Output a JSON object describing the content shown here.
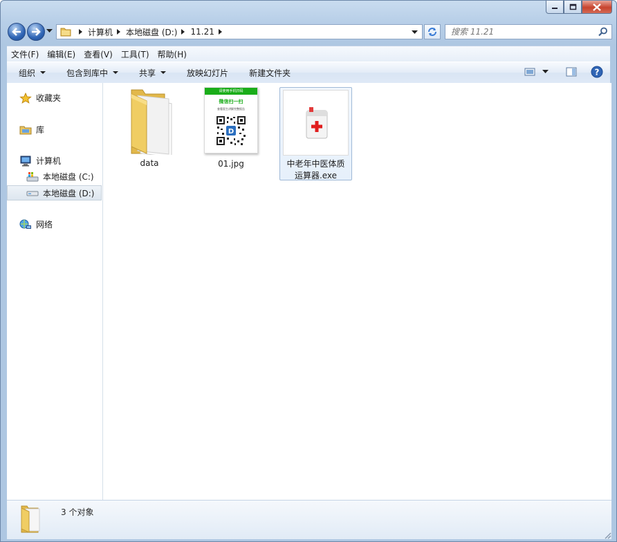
{
  "window": {
    "title": "11.21"
  },
  "address": {
    "crumbs": [
      "计算机",
      "本地磁盘 (D:)",
      "11.21"
    ]
  },
  "search": {
    "placeholder": "搜索 11.21"
  },
  "menu": [
    "文件(F)",
    "编辑(E)",
    "查看(V)",
    "工具(T)",
    "帮助(H)"
  ],
  "toolbar": {
    "organize": "组织",
    "include_library": "包含到库中",
    "share": "共享",
    "slideshow": "放映幻灯片",
    "new_folder": "新建文件夹"
  },
  "nav": {
    "favorites": "收藏夹",
    "libraries": "库",
    "computer": "计算机",
    "drive_c": "本地磁盘 (C:)",
    "drive_d": "本地磁盘 (D:)",
    "network": "网络"
  },
  "files": [
    {
      "name": "data",
      "type": "folder"
    },
    {
      "name": "01.jpg",
      "type": "image"
    },
    {
      "name": "中老年中医体质运算器.exe",
      "type": "exe",
      "line1": "中老年中医体质",
      "line2": "运算器.exe"
    }
  ],
  "qr_image": {
    "header": "请使用手机扫码",
    "title": "微信扫一扫",
    "caption": "查看医生讲解完整报告",
    "badge": "D"
  },
  "status": {
    "count": "3 个对象"
  },
  "colors": {
    "accent": "#2f65b5",
    "close": "#c7432d",
    "qr_green": "#1aad19"
  }
}
